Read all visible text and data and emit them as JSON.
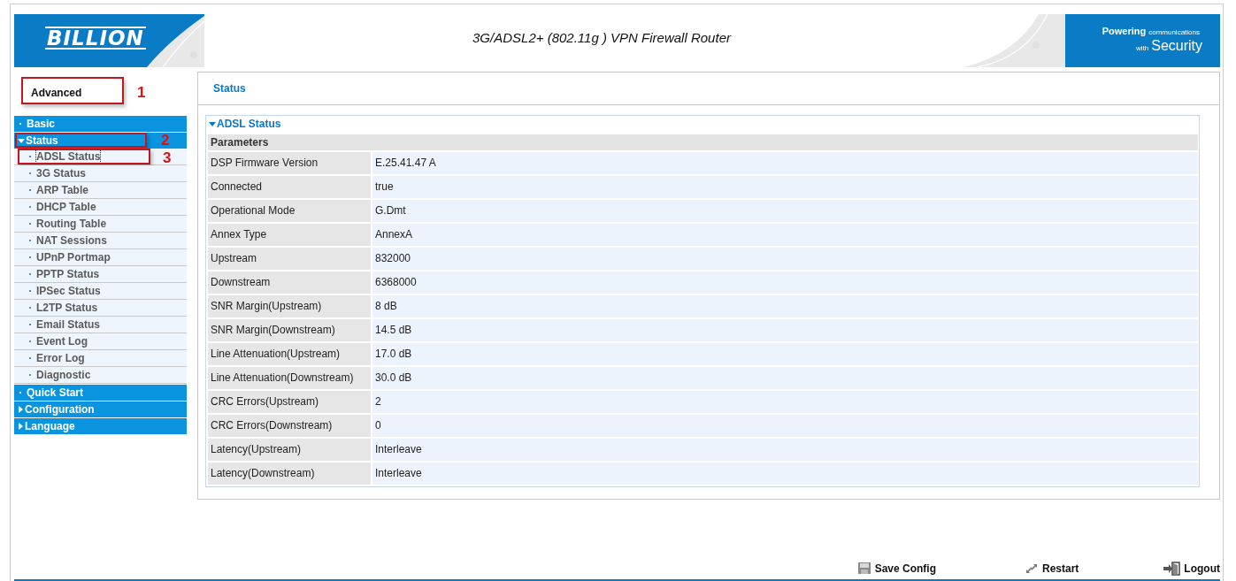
{
  "header": {
    "logo": "BILLION",
    "title": "3G/ADSL2+ (802.11g ) VPN Firewall Router",
    "slogan": {
      "line1_bold": "Powering",
      "line1": "communications",
      "line2_small": "with",
      "line2": "Security"
    }
  },
  "mode_label": {
    "text": "Advanced",
    "callout": "1"
  },
  "nav": [
    {
      "label": "Basic",
      "kind": "link"
    },
    {
      "label": "Status",
      "kind": "group",
      "expanded": true,
      "callout": "2",
      "children": [
        {
          "label": "ADSL Status",
          "selected": true,
          "callout": "3"
        },
        {
          "label": "3G Status",
          "selected": false
        },
        {
          "label": "ARP Table",
          "selected": false
        },
        {
          "label": "DHCP Table",
          "selected": false
        },
        {
          "label": "Routing Table",
          "selected": false
        },
        {
          "label": "NAT Sessions",
          "selected": false
        },
        {
          "label": "UPnP Portmap",
          "selected": false
        },
        {
          "label": "PPTP Status",
          "selected": false
        },
        {
          "label": "IPSec Status",
          "selected": false
        },
        {
          "label": "L2TP Status",
          "selected": false
        },
        {
          "label": "Email Status",
          "selected": false
        },
        {
          "label": "Event Log",
          "selected": false
        },
        {
          "label": "Error Log",
          "selected": false
        },
        {
          "label": "Diagnostic",
          "selected": false
        }
      ]
    },
    {
      "label": "Quick Start",
      "kind": "link"
    },
    {
      "label": "Configuration",
      "kind": "group",
      "expanded": false
    },
    {
      "label": "Language",
      "kind": "group",
      "expanded": false
    }
  ],
  "page_title": "Status",
  "section": {
    "title": "ADSL Status",
    "expanded": true,
    "header": "Parameters",
    "rows": [
      {
        "name": "DSP Firmware Version",
        "value": "E.25.41.47 A"
      },
      {
        "name": "Connected",
        "value": "true"
      },
      {
        "name": "Operational Mode",
        "value": "G.Dmt"
      },
      {
        "name": "Annex Type",
        "value": "AnnexA"
      },
      {
        "name": "Upstream",
        "value": "832000"
      },
      {
        "name": "Downstream",
        "value": "6368000"
      },
      {
        "name": "SNR Margin(Upstream)",
        "value": "8 dB"
      },
      {
        "name": "SNR Margin(Downstream)",
        "value": "14.5 dB"
      },
      {
        "name": "Line Attenuation(Upstream)",
        "value": "17.0 dB"
      },
      {
        "name": "Line Attenuation(Downstream)",
        "value": "30.0 dB"
      },
      {
        "name": "CRC Errors(Upstream)",
        "value": "2"
      },
      {
        "name": "CRC Errors(Downstream)",
        "value": "0"
      },
      {
        "name": "Latency(Upstream)",
        "value": "Interleave"
      },
      {
        "name": "Latency(Downstream)",
        "value": "Interleave"
      }
    ]
  },
  "footer": [
    {
      "label": "Save Config",
      "kind": "save"
    },
    {
      "label": "Restart",
      "kind": "restart"
    },
    {
      "label": "Logout",
      "kind": "logout"
    }
  ]
}
